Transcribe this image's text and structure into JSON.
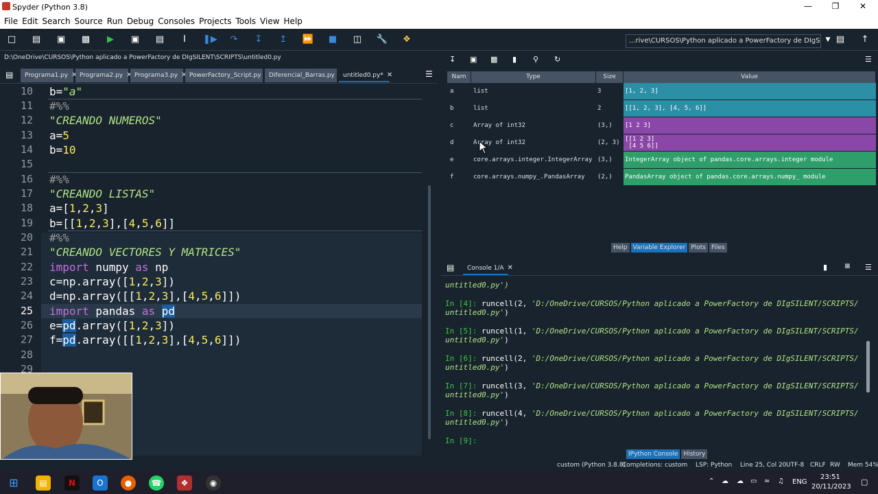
{
  "window": {
    "title": "Spyder (Python 3.8)",
    "minimize": "—",
    "maximize": "❐",
    "close": "✕"
  },
  "menu": [
    "File",
    "Edit",
    "Search",
    "Source",
    "Run",
    "Debug",
    "Consoles",
    "Projects",
    "Tools",
    "View",
    "Help"
  ],
  "toolbar": {
    "working_dir": "...rive\\CURSOS\\Python aplicado a PowerFactory de DIgSILENT\\SCRIPTS"
  },
  "editor": {
    "file_path": "D:\\OneDrive\\CURSOS\\Python aplicado a PowerFactory de DIgSILENT\\SCRIPTS\\untitled0.py",
    "tabs": [
      "Programa1.py",
      "Programa2.py",
      "Programa3.py",
      "PowerFactory_Script.py",
      "Diferencial_Barras.py",
      "untitled0.py*"
    ],
    "line_numbers": [
      "10",
      "11",
      "12",
      "13",
      "14",
      "15",
      "16",
      "17",
      "18",
      "19",
      "20",
      "21",
      "22",
      "23",
      "24",
      "25",
      "26",
      "27",
      "28",
      "29"
    ],
    "current_line": "25"
  },
  "variable_explorer": {
    "columns": [
      "Nam",
      "Type",
      "Size",
      "Value"
    ],
    "rows": [
      {
        "name": "a",
        "type": "list",
        "size": "3",
        "value": "[1, 2, 3]",
        "color": "#2b8fa6"
      },
      {
        "name": "b",
        "type": "list",
        "size": "2",
        "value": "[[1, 2, 3], [4, 5, 6]]",
        "color": "#2b8fa6"
      },
      {
        "name": "c",
        "type": "Array of int32",
        "size": "(3,)",
        "value": "[1 2 3]",
        "color": "#8a47a8"
      },
      {
        "name": "d",
        "type": "Array of int32",
        "size": "(2, 3)",
        "value": "[[1 2 3]\n [4 5 6]]",
        "color": "#8a47a8"
      },
      {
        "name": "e",
        "type": "core.arrays.integer.IntegerArray",
        "size": "(3,)",
        "value": "IntegerArray object of pandas.core.arrays.integer module",
        "color": "#2e9e6a"
      },
      {
        "name": "f",
        "type": "core.arrays.numpy_.PandasArray",
        "size": "(2,)",
        "value": "PandasArray object of pandas.core.arrays.numpy_ module",
        "color": "#2e9e6a"
      }
    ],
    "tabs": [
      "Help",
      "Variable Explorer",
      "Plots",
      "Files"
    ]
  },
  "console": {
    "tab": "Console 1/A",
    "partial_top": "untitled0.py')",
    "entries": [
      {
        "prompt": "In [4]:",
        "cmd": "runcell(2, ",
        "path": "'D:/OneDrive/CURSOS/Python aplicado a PowerFactory de DIgSILENT/SCRIPTS/",
        "path2": "untitled0.py'",
        "close": ")"
      },
      {
        "prompt": "In [5]:",
        "cmd": "runcell(1, ",
        "path": "'D:/OneDrive/CURSOS/Python aplicado a PowerFactory de DIgSILENT/SCRIPTS/",
        "path2": "untitled0.py'",
        "close": ")"
      },
      {
        "prompt": "In [6]:",
        "cmd": "runcell(2, ",
        "path": "'D:/OneDrive/CURSOS/Python aplicado a PowerFactory de DIgSILENT/SCRIPTS/",
        "path2": "untitled0.py'",
        "close": ")"
      },
      {
        "prompt": "In [7]:",
        "cmd": "runcell(3, ",
        "path": "'D:/OneDrive/CURSOS/Python aplicado a PowerFactory de DIgSILENT/SCRIPTS/",
        "path2": "untitled0.py'",
        "close": ")"
      },
      {
        "prompt": "In [8]:",
        "cmd": "runcell(4, ",
        "path": "'D:/OneDrive/CURSOS/Python aplicado a PowerFactory de DIgSILENT/SCRIPTS/",
        "path2": "untitled0.py'",
        "close": ")"
      }
    ],
    "current_prompt": "In [9]:",
    "tabs": [
      "IPython Console",
      "History"
    ]
  },
  "status": {
    "env": "custom (Python 3.8.8)",
    "completions": "Completions: custom",
    "lsp": "LSP: Python",
    "position": "Line 25, Col 20",
    "encoding": "UTF-8",
    "eol": "CRLF",
    "rw": "RW",
    "mem": "Mem 54%"
  },
  "taskbar": {
    "lang": "ENG",
    "time": "23:51",
    "date": "20/11/2023"
  }
}
